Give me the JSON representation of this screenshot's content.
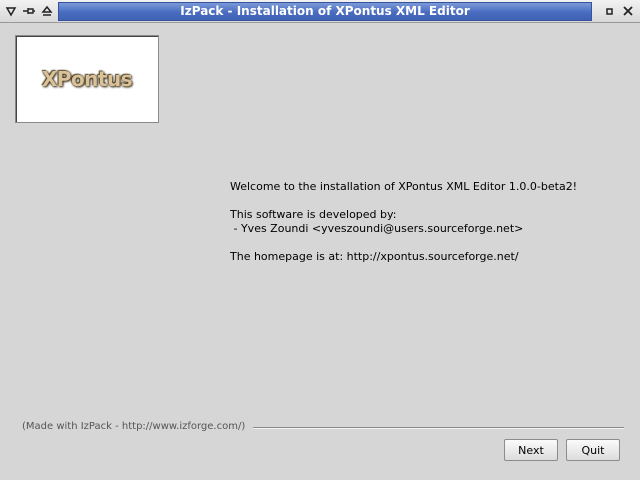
{
  "window": {
    "title": "IzPack - Installation of  XPontus XML Editor",
    "buttons": [
      "menu-icon",
      "pin-icon",
      "shade-icon",
      "close-icon"
    ]
  },
  "logo": {
    "text": "XPontus"
  },
  "content": {
    "welcome": "Welcome to the installation of XPontus XML Editor 1.0.0-beta2!",
    "developed_by": "This software is developed by:",
    "author": " - Yves Zoundi <yveszoundi@users.sourceforge.net>",
    "homepage": "The homepage is at: http://xpontus.sourceforge.net/"
  },
  "footer": {
    "made_with": "(Made with IzPack - http://www.izforge.com/)",
    "next_label": "Next",
    "quit_label": "Quit"
  },
  "colors": {
    "title_blue": "#4a6cc0",
    "background": "#d6d6d6"
  }
}
